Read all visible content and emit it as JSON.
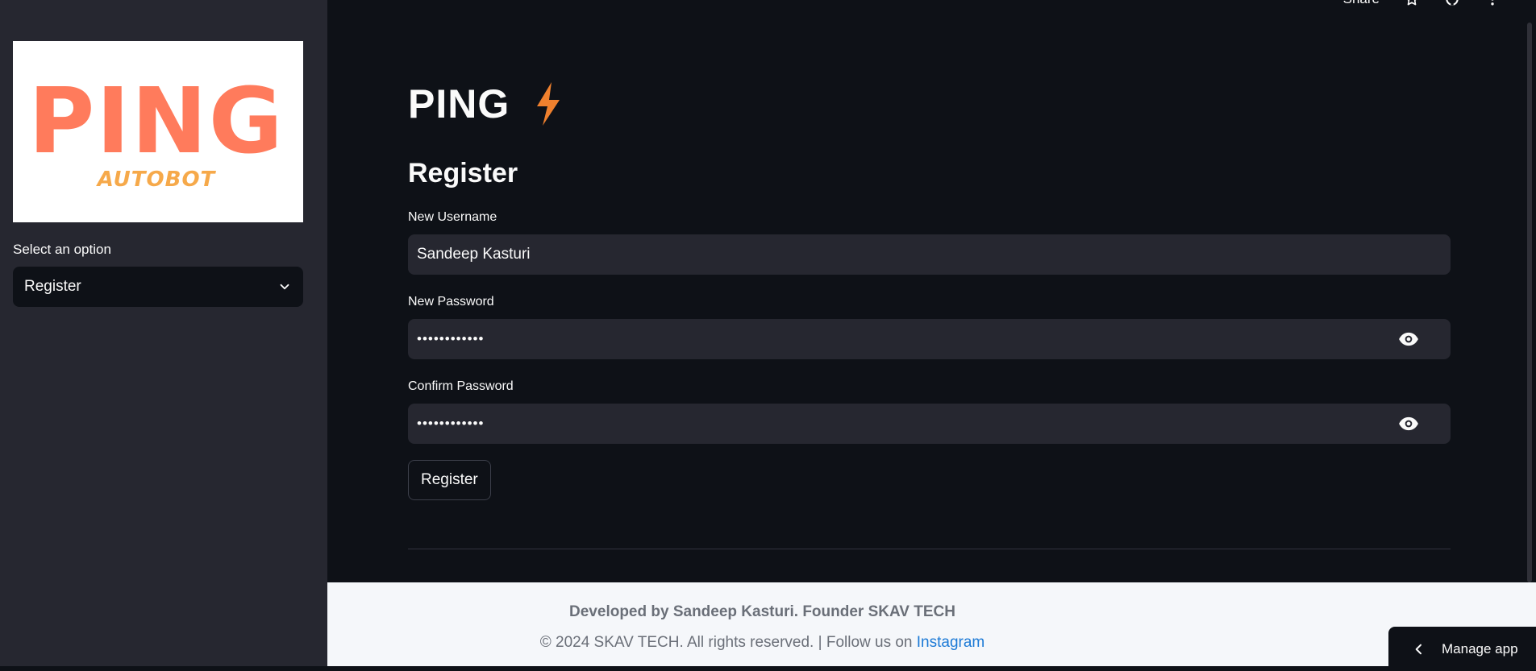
{
  "sidebar": {
    "logo": {
      "title": "PING",
      "subtitle": "AUTOBOT",
      "title_color": "#ff7b5c",
      "subtitle_color": "#f6a94a"
    },
    "select_label": "Select an option",
    "select_value": "Register"
  },
  "topbar": {
    "share_label": "Share",
    "icons": [
      "star-icon",
      "github-icon",
      "more-vertical-icon"
    ]
  },
  "main": {
    "app_title": "PING",
    "title_icon": "lightning-bolt-icon",
    "accent": "#f0812e",
    "section_title": "Register",
    "fields": [
      {
        "label": "New Username",
        "value": "Sandeep Kasturi"
      },
      {
        "label": "New Password",
        "value": "••••••••••••"
      },
      {
        "label": "Confirm Password",
        "value": "••••••••••••"
      }
    ],
    "submit_label": "Register"
  },
  "footer": {
    "line1": "Developed by Sandeep Kasturi. Founder SKAV TECH",
    "line2_text": "© 2024 SKAV TECH. All rights reserved. | Follow us on ",
    "line2_link": "Instagram",
    "link_color": "#1c7ad6"
  },
  "manage_app": {
    "label": "Manage app"
  }
}
